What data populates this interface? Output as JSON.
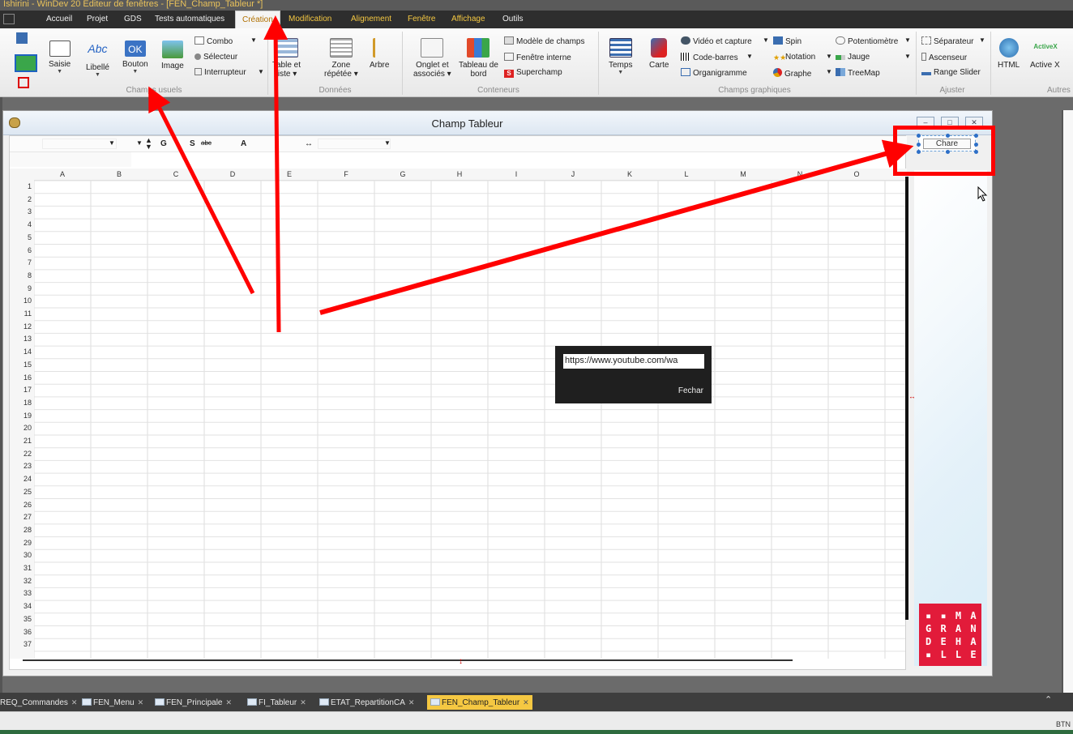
{
  "app": {
    "title": "Ishirini - WinDev 20  Editeur de fenêtres - [FEN_Champ_Tableur *]"
  },
  "menu": {
    "items": [
      "Accueil",
      "Projet",
      "GDS",
      "Tests automatiques",
      "Création",
      "Modification",
      "Alignement",
      "Fenêtre",
      "Affichage",
      "Outils"
    ],
    "active": "Création"
  },
  "ribbon": {
    "champs_usuels": {
      "saisie": "Saisie",
      "libelle": "Libellé",
      "bouton": "Bouton",
      "bouton_icon_text": "OK",
      "libelle_icon_text": "Abc",
      "image": "Image",
      "combo": "Combo",
      "selecteur": "Sélecteur",
      "interrupteur": "Interrupteur",
      "group": "Champs usuels"
    },
    "donnees": {
      "table_et_liste_1": "Table et",
      "table_et_liste_2": "liste",
      "zone_repetee_1": "Zone",
      "zone_repetee_2": "répétée",
      "arbre": "Arbre",
      "group": "Données"
    },
    "conteneurs": {
      "onglet_1": "Onglet et",
      "onglet_2": "associés",
      "tableau_1": "Tableau de",
      "tableau_2": "bord",
      "modele": "Modèle de champs",
      "fenetre_interne": "Fenêtre interne",
      "superchamp": "Superchamp",
      "group": "Conteneurs"
    },
    "champs_graphiques": {
      "temps": "Temps",
      "carte": "Carte",
      "video": "Vidéo et capture",
      "codebarres": "Code-barres",
      "organigramme": "Organigramme",
      "spin": "Spin",
      "notation": "Notation",
      "graphe": "Graphe",
      "potentiometre": "Potentiomètre",
      "jauge": "Jauge",
      "treemap": "TreeMap",
      "group": "Champs graphiques"
    },
    "ajuster": {
      "separateur": "Séparateur",
      "ascenseur": "Ascenseur",
      "range_slider": "Range Slider",
      "group": "Ajuster"
    },
    "autres": {
      "html": "HTML",
      "activex": "Active X",
      "activex_icon_text": "ActiveX",
      "group": "Autres"
    }
  },
  "window": {
    "title": "Champ Tableur"
  },
  "sheet": {
    "toolbar": {
      "bold": "G",
      "strike": "S",
      "strike2": "abc",
      "font": "A",
      "width": "↔"
    },
    "columns": [
      "A",
      "B",
      "C",
      "D",
      "E",
      "F",
      "G",
      "H",
      "I",
      "J",
      "K",
      "L",
      "M",
      "N",
      "O"
    ],
    "rows": [
      "1",
      "2",
      "3",
      "4",
      "5",
      "6",
      "7",
      "8",
      "9",
      "10",
      "11",
      "12",
      "13",
      "14",
      "15",
      "16",
      "17",
      "18",
      "19",
      "20",
      "21",
      "22",
      "23",
      "24",
      "25",
      "26",
      "27",
      "28",
      "29",
      "30",
      "31",
      "32",
      "33",
      "34",
      "35",
      "36",
      "37"
    ]
  },
  "selected_button": {
    "label": "Chare"
  },
  "popup": {
    "url": "https://www.youtube.com/wa",
    "close": "Fechar"
  },
  "logo": {
    "lines": [
      "▪ ▪ M A",
      "G R A N",
      "D E H A",
      "▪ L L E"
    ]
  },
  "doc_tabs": [
    {
      "label": "REQ_Commandes"
    },
    {
      "label": "FEN_Menu"
    },
    {
      "label": "FEN_Principale"
    },
    {
      "label": "FI_Tableur"
    },
    {
      "label": "ETAT_RepartitionCA"
    },
    {
      "label": "FEN_Champ_Tableur"
    }
  ],
  "status": {
    "right": "BTN"
  },
  "colors": {
    "highlight": "#ff0000",
    "logo": "#e21b3a",
    "tab_active": "#f5c842",
    "menu_bg": "#2e2e2e"
  }
}
